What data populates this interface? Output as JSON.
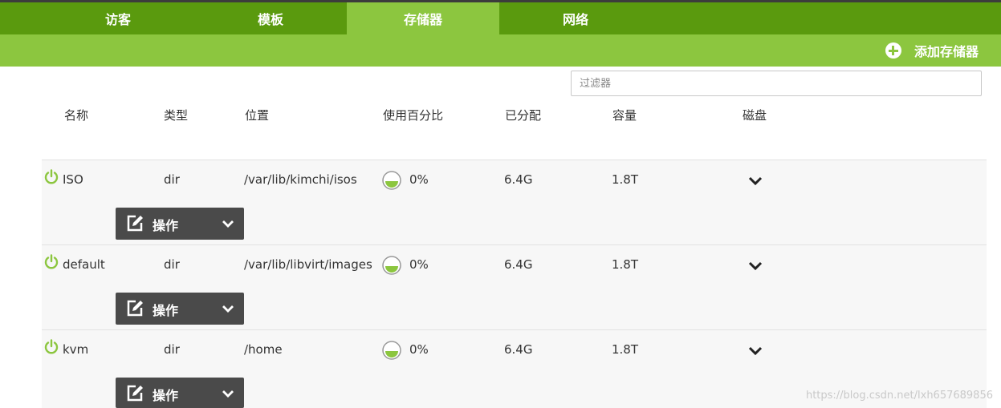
{
  "tabs": [
    {
      "label": "访客",
      "active": false
    },
    {
      "label": "模板",
      "active": false
    },
    {
      "label": "存储器",
      "active": true
    },
    {
      "label": "网络",
      "active": false
    }
  ],
  "actions": {
    "add_label": "添加存储器"
  },
  "filter": {
    "placeholder": "过滤器",
    "value": ""
  },
  "table": {
    "headers": {
      "name": "名称",
      "type": "类型",
      "location": "位置",
      "usage": "使用百分比",
      "allocated": "已分配",
      "capacity": "容量",
      "disks": "磁盘"
    },
    "rows": [
      {
        "name": "ISO",
        "type": "dir",
        "location": "/var/lib/kimchi/isos",
        "usage": "0%",
        "allocated": "6.4G",
        "capacity": "1.8T",
        "action_label": "操作",
        "status": "active"
      },
      {
        "name": "default",
        "type": "dir",
        "location": "/var/lib/libvirt/images",
        "usage": "0%",
        "allocated": "6.4G",
        "capacity": "1.8T",
        "action_label": "操作",
        "status": "active"
      },
      {
        "name": "kvm",
        "type": "dir",
        "location": "/home",
        "usage": "0%",
        "allocated": "6.4G",
        "capacity": "1.8T",
        "action_label": "操作",
        "status": "active"
      }
    ]
  },
  "watermark": "https://blog.csdn.net/lxh657689856",
  "colors": {
    "brand_dark": "#5a9a0e",
    "brand_light": "#8cc63f",
    "button_dark": "#4a4a4a"
  }
}
